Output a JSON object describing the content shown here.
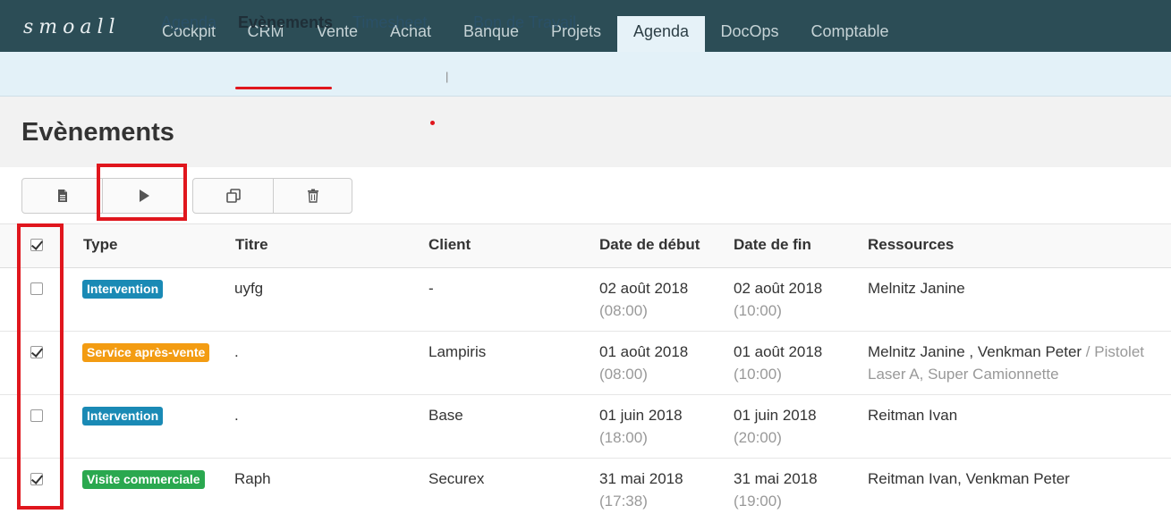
{
  "app": {
    "logo": "smoall"
  },
  "topnav": {
    "items": [
      {
        "label": "Cockpit"
      },
      {
        "label": "CRM"
      },
      {
        "label": "Vente"
      },
      {
        "label": "Achat"
      },
      {
        "label": "Banque"
      },
      {
        "label": "Projets"
      },
      {
        "label": "Agenda",
        "active": true
      },
      {
        "label": "DocOps"
      },
      {
        "label": "Comptable"
      }
    ]
  },
  "subnav": {
    "items": [
      {
        "label": "Agenda"
      },
      {
        "label": "Evènements",
        "active": true
      },
      {
        "label": "Timesheet"
      },
      {
        "label": "|"
      },
      {
        "label": "Bon de Travail"
      }
    ]
  },
  "page": {
    "title": "Evènements"
  },
  "toolbar": {
    "buttons": [
      {
        "icon": "document-icon"
      },
      {
        "icon": "play-icon"
      },
      {
        "icon": "copy-icon"
      },
      {
        "icon": "trash-icon"
      }
    ]
  },
  "table": {
    "columns": [
      "Type",
      "Titre",
      "Client",
      "Date de début",
      "Date de fin",
      "Ressources"
    ],
    "rows": [
      {
        "checked": false,
        "type": "Intervention",
        "type_color": "#1a8ab5",
        "title": "uyfg",
        "client": "-",
        "start_date": "02 août 2018",
        "start_time": "(08:00)",
        "end_date": "02 août 2018",
        "end_time": "(10:00)",
        "resources": "Melnitz Janine",
        "resources_extra": ""
      },
      {
        "checked": true,
        "type": "Service après-vente",
        "type_color": "#f39c12",
        "title": ".",
        "client": "Lampiris",
        "start_date": "01 août 2018",
        "start_time": "(08:00)",
        "end_date": "01 août 2018",
        "end_time": "(10:00)",
        "resources": "Melnitz Janine , Venkman Peter",
        "resources_extra": " / Pistolet",
        "resources_extra2": "Laser A, Super Camionnette"
      },
      {
        "checked": false,
        "type": "Intervention",
        "type_color": "#1a8ab5",
        "title": ".",
        "client": "Base",
        "start_date": "01 juin 2018",
        "start_time": "(18:00)",
        "end_date": "01 juin 2018",
        "end_time": "(20:00)",
        "resources": "Reitman Ivan",
        "resources_extra": ""
      },
      {
        "checked": true,
        "type": "Visite commerciale",
        "type_color": "#2aa84f",
        "title": "Raph",
        "client": "Securex",
        "start_date": "31 mai 2018",
        "start_time": "(17:38)",
        "end_date": "31 mai 2018",
        "end_time": "(19:00)",
        "resources": "Reitman Ivan, Venkman Peter",
        "resources_extra": ""
      }
    ]
  },
  "colors": {
    "topbar": "#2c4d56",
    "subbar": "#e3f1f8",
    "highlight": "#e0161d"
  }
}
